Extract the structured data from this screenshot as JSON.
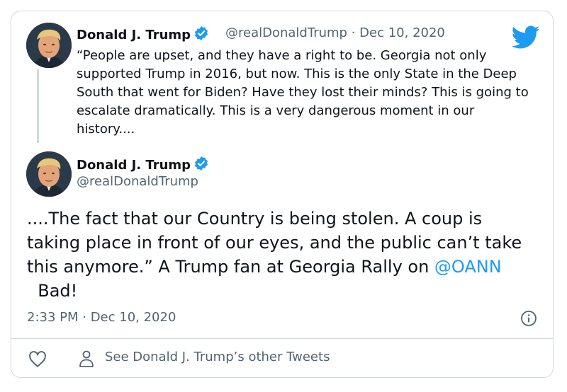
{
  "colors": {
    "accent": "#1d9bf0",
    "muted": "#536471",
    "text": "#0f1419",
    "border": "#cfd9de"
  },
  "quoted_tweet": {
    "author_name": "Donald J. Trump",
    "handle": "@realDonaldTrump",
    "separator": "·",
    "date": "Dec 10, 2020",
    "text": "“People are upset, and they have a right to be. Georgia not only supported Trump in 2016, but now. This is the only State in the Deep South that went for Biden? Have they lost their minds? This is going to escalate dramatically. This is a very dangerous moment in our history...."
  },
  "main_tweet": {
    "author_name": "Donald J. Trump",
    "handle": "@realDonaldTrump",
    "text_before": "....The fact that our Country is being stolen. A coup is taking place in front of our eyes, and the public can’t take this anymore.” A Trump fan at Georgia Rally on ",
    "mention": "@OANN",
    "text_after": "  Bad!",
    "timestamp": "2:33 PM · Dec 10, 2020"
  },
  "footer": {
    "other_tweets_label": "See Donald J. Trump’s other Tweets"
  },
  "icons": [
    "twitter-bird-icon",
    "verified-badge-icon",
    "info-icon",
    "heart-icon",
    "person-icon"
  ]
}
